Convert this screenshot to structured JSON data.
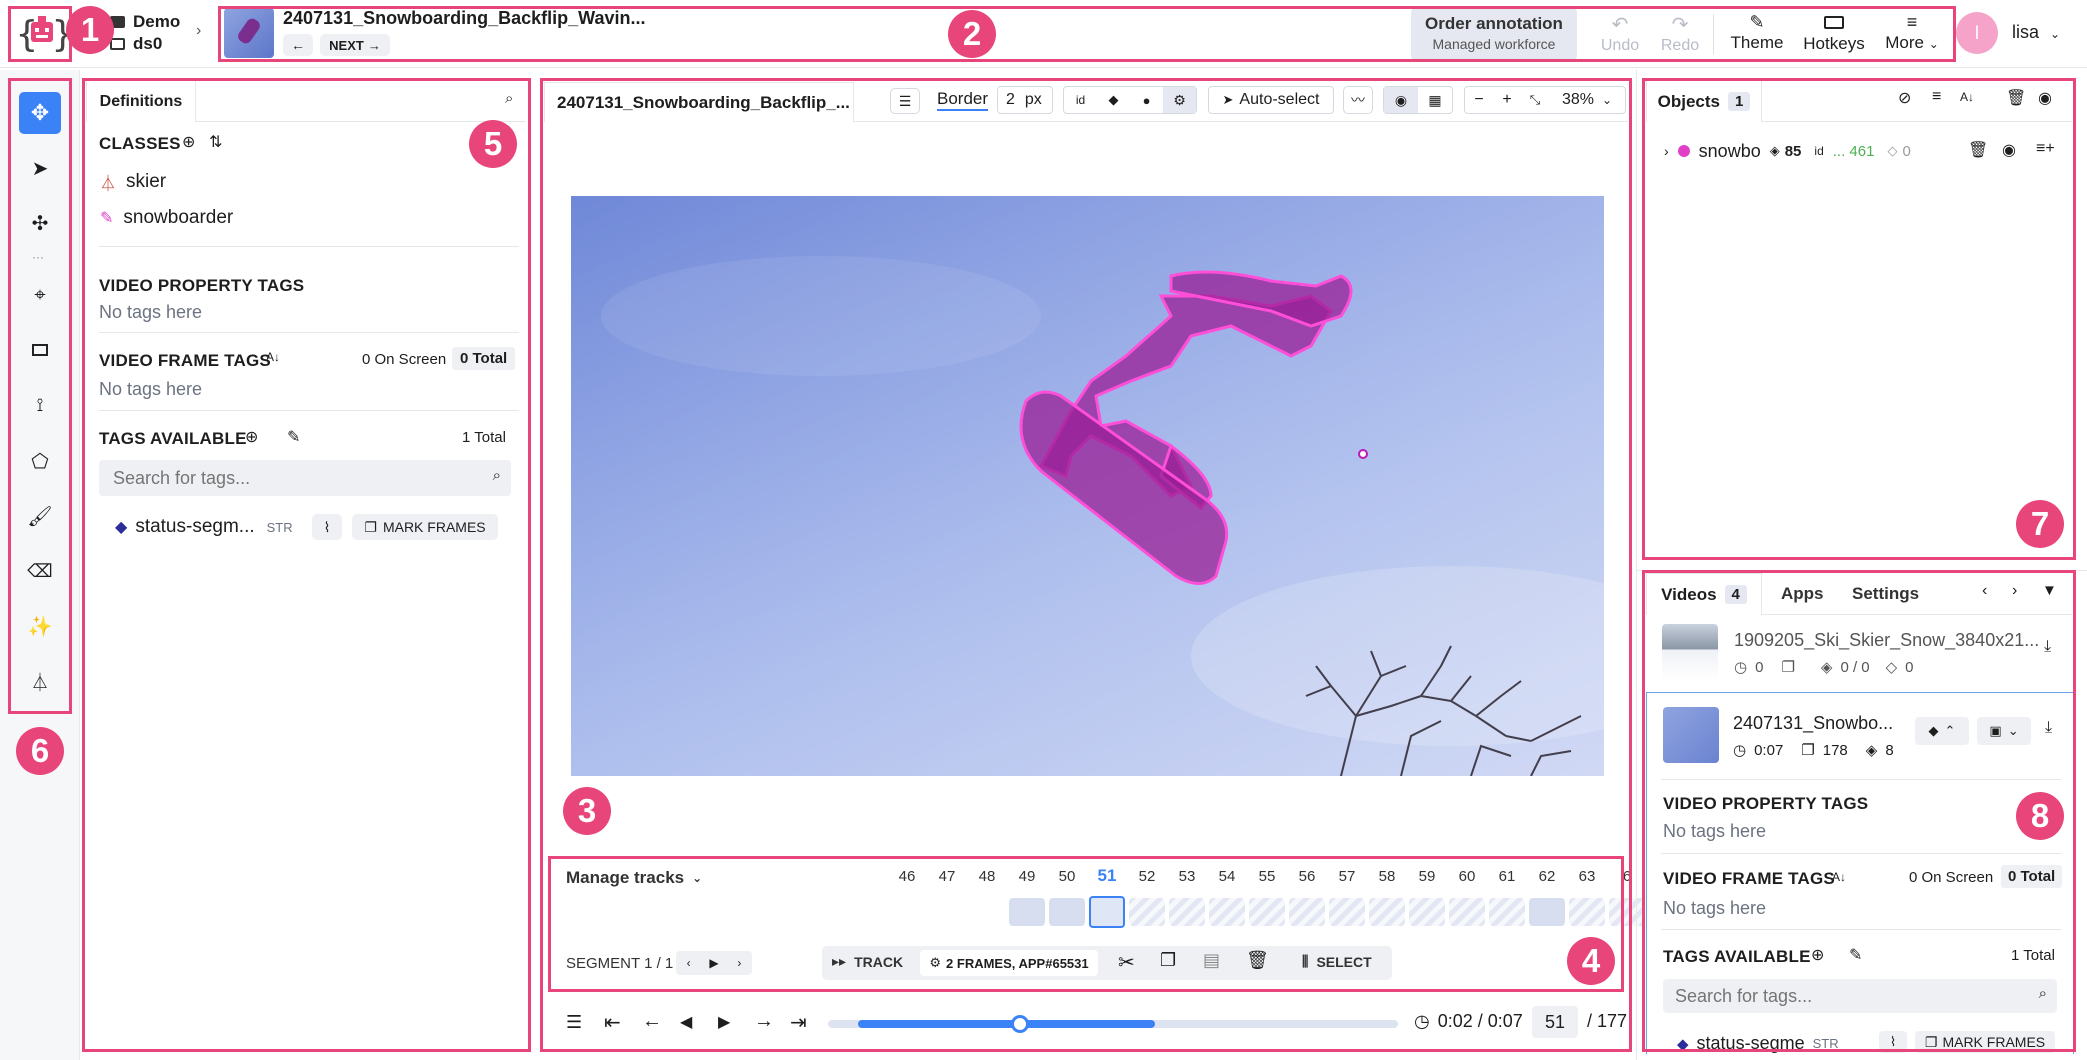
{
  "app": {
    "workspace": "Demo",
    "dataset": "ds0",
    "video_title": "2407131_Snowboarding_Backflip_Wavin...",
    "next_label": "NEXT",
    "order": {
      "title": "Order annotation",
      "subtitle": "Managed workforce"
    },
    "undo": "Undo",
    "redo": "Redo",
    "theme": "Theme",
    "hotkeys": "Hotkeys",
    "more": "More",
    "user_initial": "l",
    "user_name": "lisa"
  },
  "left_panel": {
    "tab": "Definitions",
    "classes_title": "CLASSES",
    "classes": [
      {
        "name": "skier",
        "color": "#c0392b",
        "icon": "graph-icon"
      },
      {
        "name": "snowboarder",
        "color": "#e040c8",
        "icon": "brush-icon"
      }
    ],
    "video_property_tags": "VIDEO PROPERTY TAGS",
    "no_tags_1": "No tags here",
    "video_frame_tags": "VIDEO FRAME TAGS",
    "on_screen": "0 On Screen",
    "total": "0 Total",
    "no_tags_2": "No tags here",
    "tags_available": "TAGS AVAILABLE",
    "tags_total": "1 Total",
    "search_placeholder": "Search for tags...",
    "tag_name": "status-segm...",
    "tag_type": "STR",
    "mark_frames": "MARK FRAMES"
  },
  "viewer": {
    "tab_title": "2407131_Snowboarding_Backflip_...",
    "border_label": "Border",
    "border_value": "2",
    "border_unit": "px",
    "id_label": "id",
    "auto_select": "Auto-select",
    "zoom": "38%"
  },
  "timeline": {
    "manage_tracks": "Manage tracks",
    "frames": [
      "46",
      "47",
      "48",
      "49",
      "50",
      "51",
      "52",
      "53",
      "54",
      "55",
      "56",
      "57",
      "58",
      "59",
      "60",
      "61",
      "62",
      "63",
      "6"
    ],
    "current_frame": "51",
    "segment": "SEGMENT 1 / 1",
    "track": "TRACK",
    "track_info": "2 FRAMES, APP#65531",
    "select": "SELECT",
    "time": "0:02 / 0:07",
    "frame_input": "51",
    "frame_total": "/ 177",
    "progress": 0.55
  },
  "objects": {
    "tab": "Objects",
    "count": "1",
    "item": {
      "name": "snowbo",
      "layers": "85",
      "id_label": "id",
      "id_value": "... 461",
      "tags": "0",
      "color": "#e040c8"
    }
  },
  "videos": {
    "tab": "Videos",
    "count": "4",
    "apps": "Apps",
    "settings": "Settings",
    "items": [
      {
        "name": "1909205_Ski_Skier_Snow_3840x21...",
        "duration": "0",
        "frames": "",
        "figures": "0 / 0",
        "tags": "0"
      },
      {
        "name": "2407131_Snowbo...",
        "duration": "0:07",
        "frames": "178",
        "figures": "8"
      }
    ],
    "video_property_tags": "VIDEO PROPERTY TAGS",
    "no_tags_1": "No tags here",
    "video_frame_tags": "VIDEO FRAME TAGS",
    "on_screen": "0 On Screen",
    "total": "0 Total",
    "no_tags_2": "No tags here",
    "tags_available": "TAGS AVAILABLE",
    "tags_total": "1 Total",
    "search_placeholder": "Search for tags...",
    "tag_name": "status-segme",
    "tag_type": "STR",
    "mark_frames": "MARK FRAMES"
  },
  "annotations": [
    "1",
    "2",
    "3",
    "4",
    "5",
    "6",
    "7",
    "8"
  ],
  "colors": {
    "accent": "#3b82f6",
    "annotation": "#e8457a",
    "mask": "#b0189a"
  }
}
